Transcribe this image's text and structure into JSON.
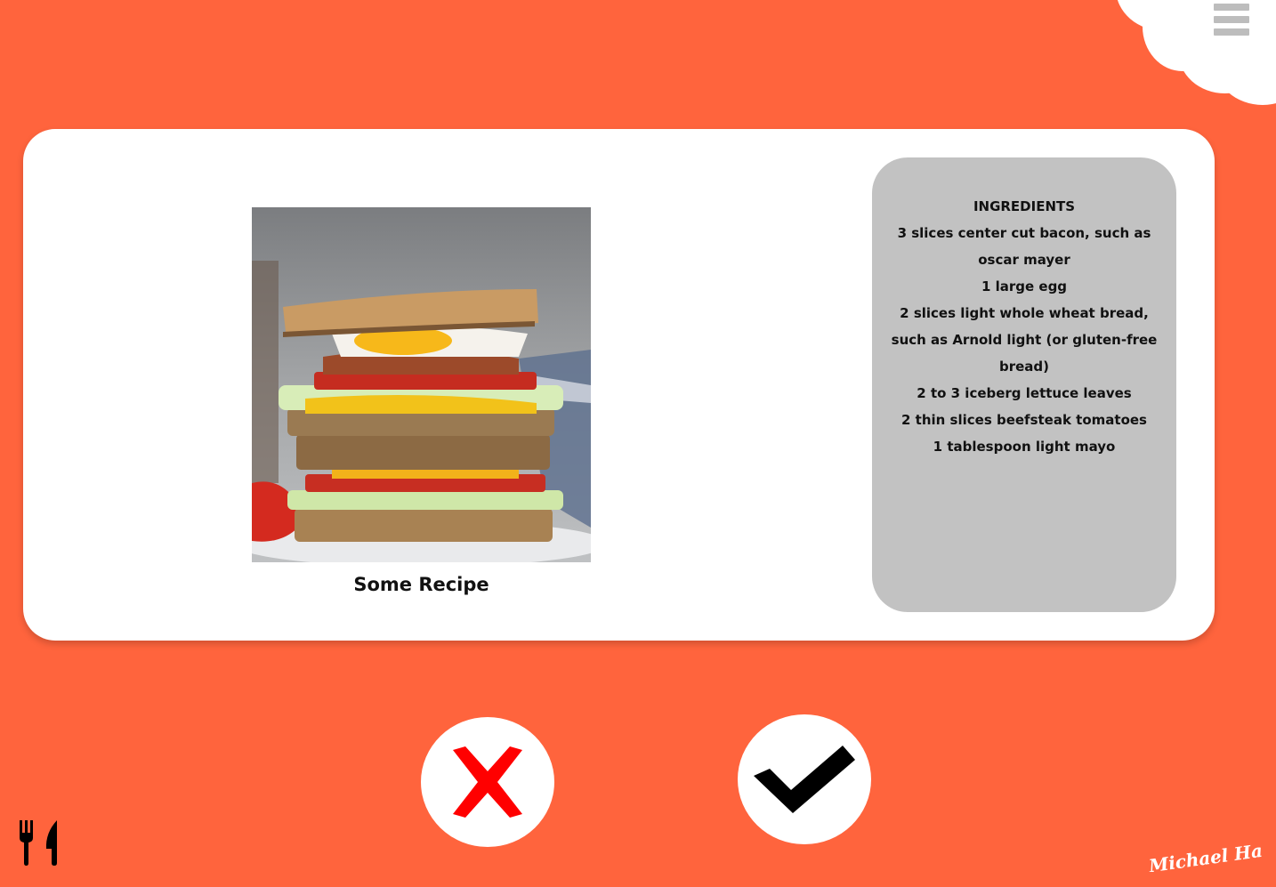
{
  "header": {
    "menu_icon": "hamburger-menu-icon"
  },
  "recipe": {
    "title": "Some Recipe",
    "photo_icon": "sandwich-photo"
  },
  "ingredients": {
    "heading": "INGREDIENTS",
    "items": [
      "3 slices center cut bacon, such as oscar mayer",
      "1 large egg",
      "2 slices light whole wheat bread, such as Arnold light (or gluten-free bread)",
      "2 to 3 iceberg lettuce leaves",
      "2 thin slices beefsteak tomatoes",
      "1 tablespoon light mayo"
    ]
  },
  "actions": {
    "reject_icon": "x-icon",
    "accept_icon": "checkmark-icon"
  },
  "footer": {
    "logo_icon": "fork-knife-icon",
    "signature": "Michael Hall"
  },
  "colors": {
    "background": "#ff643d",
    "card": "#ffffff",
    "ingredients_panel": "#c2c2c2",
    "reject": "#ff0000",
    "accept": "#000000"
  }
}
